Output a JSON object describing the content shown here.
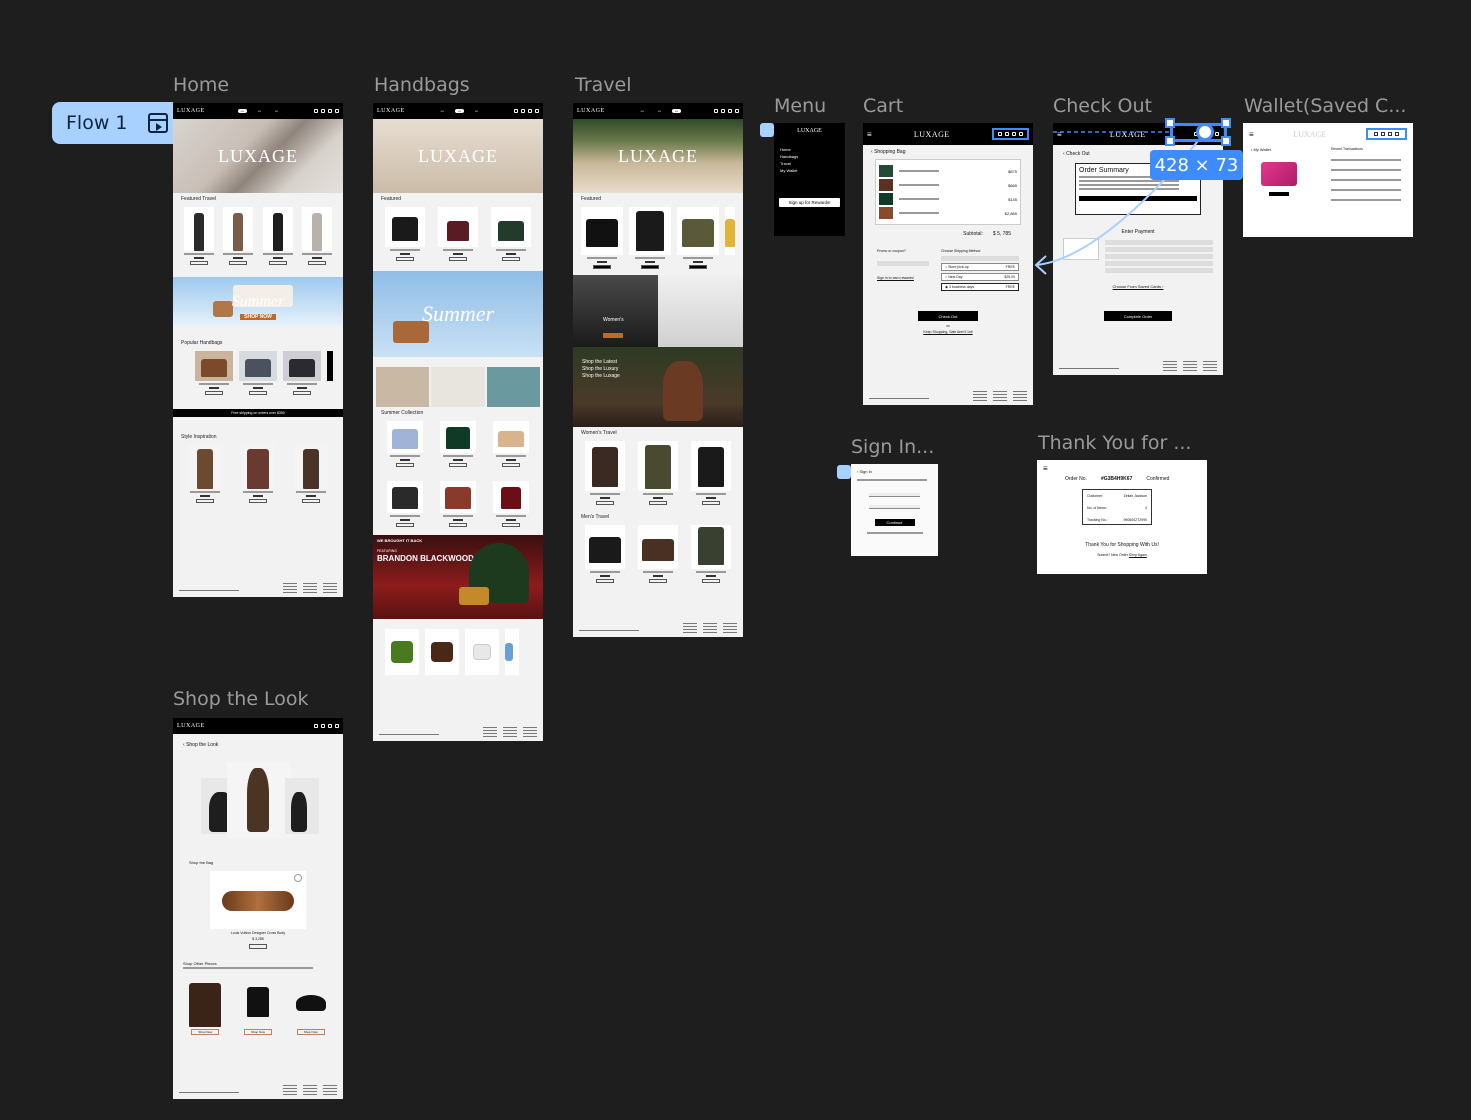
{
  "canvas": {
    "flow_label": "Flow 1",
    "selection_size": "428 × 73"
  },
  "frames": {
    "home": "Home",
    "handbags": "Handbags",
    "travel": "Travel",
    "menu": "Menu",
    "cart": "Cart",
    "checkout": "Check Out",
    "wallet": "Wallet(Saved C...",
    "signin": "Sign In...",
    "thankyou": "Thank You for ...",
    "shop_the_look": "Shop the Look"
  },
  "brand": "LUXAGE",
  "home": {
    "hero": "LUXAGE",
    "featured": "Featured Travel",
    "summer": "Summer",
    "shop_now": "SHOP NOW",
    "popular": "Popular Handbags",
    "shipping": "Free shipping on orders over $350",
    "style": "Style Inspiration"
  },
  "handbags": {
    "hero": "LUXAGE",
    "featured": "Featured",
    "summer": "Summer",
    "collection": "Summer Collection",
    "we_brought": "WE BROUGHT IT BACK",
    "featuring": "FEATURING",
    "artist": "BRANDON BLACKWOOD"
  },
  "travel": {
    "hero": "LUXAGE",
    "featured": "Featured",
    "women_banner": "Women's",
    "shop_latest": "Shop the Latest",
    "shop_luxury": "Shop the Luxury",
    "shop_luxage": "Shop the Luxage",
    "womens_travel": "Women's Travel",
    "mens_travel": "Men's Travel"
  },
  "menu": {
    "logo": "LUXAGE",
    "items": [
      "Home",
      "Handbags",
      "Travel",
      "My Wallet"
    ],
    "cta": "Sign up for Rewards!"
  },
  "cart": {
    "back": "Shopping Bag",
    "subtotal_label": "Subtotal:",
    "subtotal_value": "$ 5, 785",
    "shipping_title": "Choose Shipping Method",
    "options": [
      "Store pick-up",
      "Next Day",
      "3 business days"
    ],
    "option_prices": [
      "FREE",
      "$25.00",
      "FREE"
    ],
    "promo": "Promo or coupon?",
    "rewards": "Sign in to earn rewards!",
    "checkout": "Check Out",
    "or": "or",
    "keep": "Keep Shopping, Sale Aren't 1st!",
    "prices": [
      "$875",
      "$665",
      "$145",
      "$2,865"
    ]
  },
  "checkout": {
    "back": "Check Out",
    "summary": "Order Summary",
    "payment": "Enter Payment",
    "saved": "Choose From Saved Cards",
    "complete": "Complete Order"
  },
  "wallet": {
    "back": "My Wallet",
    "recent": "Recent Transactions"
  },
  "signin": {
    "back": "Sign In",
    "continue": "Continue"
  },
  "thankyou": {
    "order_label": "Order No.",
    "order_no": "#G3B4H9K67",
    "status": "Confirmed",
    "customer": "Customer:",
    "customer_name": "Zeliah Jackson",
    "items_label": "No. of Items:",
    "items_count": "4",
    "tracking": "Tracking No.:",
    "tracking_no": "9906042T2990",
    "thanks": "Thank You for Shopping With Us!",
    "next": "Submit? New Order",
    "shop_again": "Shop Again"
  },
  "look": {
    "back": "Shop the Look",
    "bag": "Shop the Bag",
    "bag_name": "Louis Vuitton Designer Cross Body",
    "bag_price": "$ 3,285",
    "other": "Shop Other Pieces",
    "shop_now": "Shop Now"
  }
}
